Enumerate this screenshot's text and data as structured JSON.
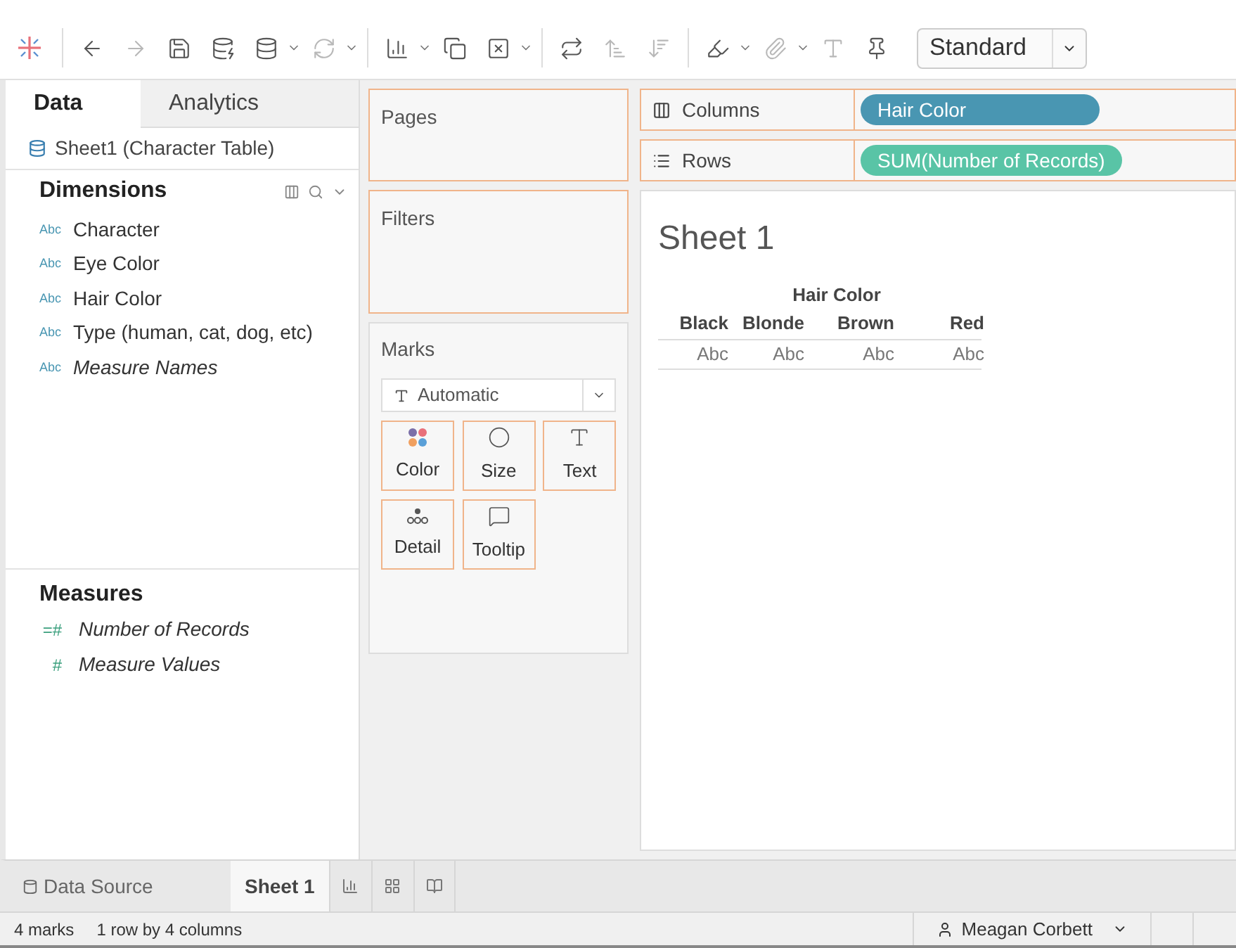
{
  "toolbar": {
    "view_size": "Standard"
  },
  "data_pane": {
    "tabs": [
      {
        "label": "Data",
        "selected": true
      },
      {
        "label": "Analytics",
        "selected": false
      }
    ],
    "data_source": "Sheet1 (Character Table)",
    "dimensions": {
      "title": "Dimensions",
      "fields": [
        {
          "badge": "Abc",
          "name": "Character",
          "italic": false
        },
        {
          "badge": "Abc",
          "name": "Eye Color",
          "italic": false
        },
        {
          "badge": "Abc",
          "name": "Hair Color",
          "italic": false
        },
        {
          "badge": "Abc",
          "name": "Type (human, cat, dog, etc)",
          "italic": false
        },
        {
          "badge": "Abc",
          "name": "Measure Names",
          "italic": true
        }
      ]
    },
    "measures": {
      "title": "Measures",
      "fields": [
        {
          "badge": "=#",
          "name": "Number of Records",
          "italic": true
        },
        {
          "badge": "#",
          "name": "Measure Values",
          "italic": true
        }
      ]
    }
  },
  "pages_shelf": {
    "title": "Pages"
  },
  "filters_shelf": {
    "title": "Filters"
  },
  "marks": {
    "title": "Marks",
    "mark_type": "Automatic",
    "cards": [
      {
        "kind": "color",
        "label": "Color"
      },
      {
        "kind": "size",
        "label": "Size"
      },
      {
        "kind": "text",
        "label": "Text"
      },
      {
        "kind": "detail",
        "label": "Detail"
      },
      {
        "kind": "tooltip",
        "label": "Tooltip"
      }
    ]
  },
  "columns_shelf": {
    "label": "Columns",
    "pills": [
      {
        "kind": "dimension",
        "text": "Hair Color"
      }
    ]
  },
  "rows_shelf": {
    "label": "Rows",
    "pills": [
      {
        "kind": "measure",
        "text": "SUM(Number of Records)"
      }
    ]
  },
  "view": {
    "title": "Sheet 1",
    "column_header": "Hair Color",
    "columns": [
      "Black",
      "Blonde",
      "Brown",
      "Red"
    ],
    "cells": [
      "Abc",
      "Abc",
      "Abc",
      "Abc"
    ]
  },
  "sheet_tabs": {
    "data_source": "Data Source",
    "sheets": [
      {
        "label": "Sheet 1",
        "selected": true
      }
    ]
  },
  "status_bar": {
    "marks": "4 marks",
    "dimensions": "1 row by 4 columns",
    "user": "Meagan Corbett"
  }
}
